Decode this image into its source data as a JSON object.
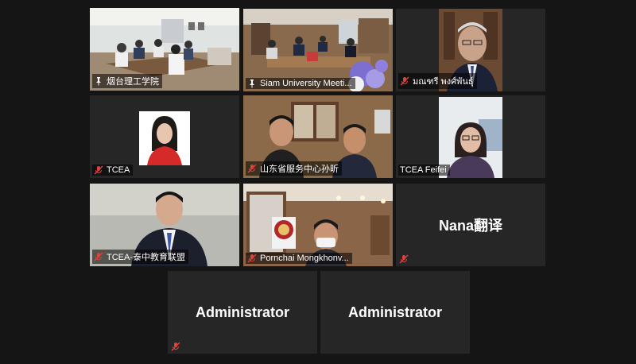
{
  "participants": [
    {
      "name": "烟台理工学院",
      "icon": "pin-icon",
      "muted": false,
      "active": true
    },
    {
      "name": "Siam University Meeti...",
      "icon": "pin-icon",
      "muted": false,
      "active": false
    },
    {
      "name": "มณฑรี พงศ์พันธุ์",
      "icon": "mic-muted-icon",
      "muted": true,
      "active": false
    },
    {
      "name": "TCEA",
      "icon": "mic-muted-icon",
      "muted": true,
      "active": false
    },
    {
      "name": "山东省服务中心孙昕",
      "icon": "mic-muted-icon",
      "muted": true,
      "active": false
    },
    {
      "name": "TCEA Feifei",
      "icon": "",
      "muted": false,
      "active": false
    },
    {
      "name": "TCEA-泰中教育联盟",
      "icon": "mic-muted-icon",
      "muted": true,
      "active": false
    },
    {
      "name": "Pornchai Mongkhonv...",
      "icon": "mic-muted-icon",
      "muted": true,
      "active": false
    },
    {
      "name": "Nana翻译",
      "icon": "mic-muted-icon",
      "muted": true,
      "active": false
    },
    {
      "name": "Administrator",
      "icon": "mic-muted-icon",
      "muted": true,
      "active": false
    },
    {
      "name": "Administrator",
      "icon": "mic-muted-icon",
      "muted": true,
      "active": false
    }
  ],
  "colors": {
    "active_outline": "#c9d64a",
    "muted_icon": "#e0413a",
    "tile_bg": "#262626"
  }
}
